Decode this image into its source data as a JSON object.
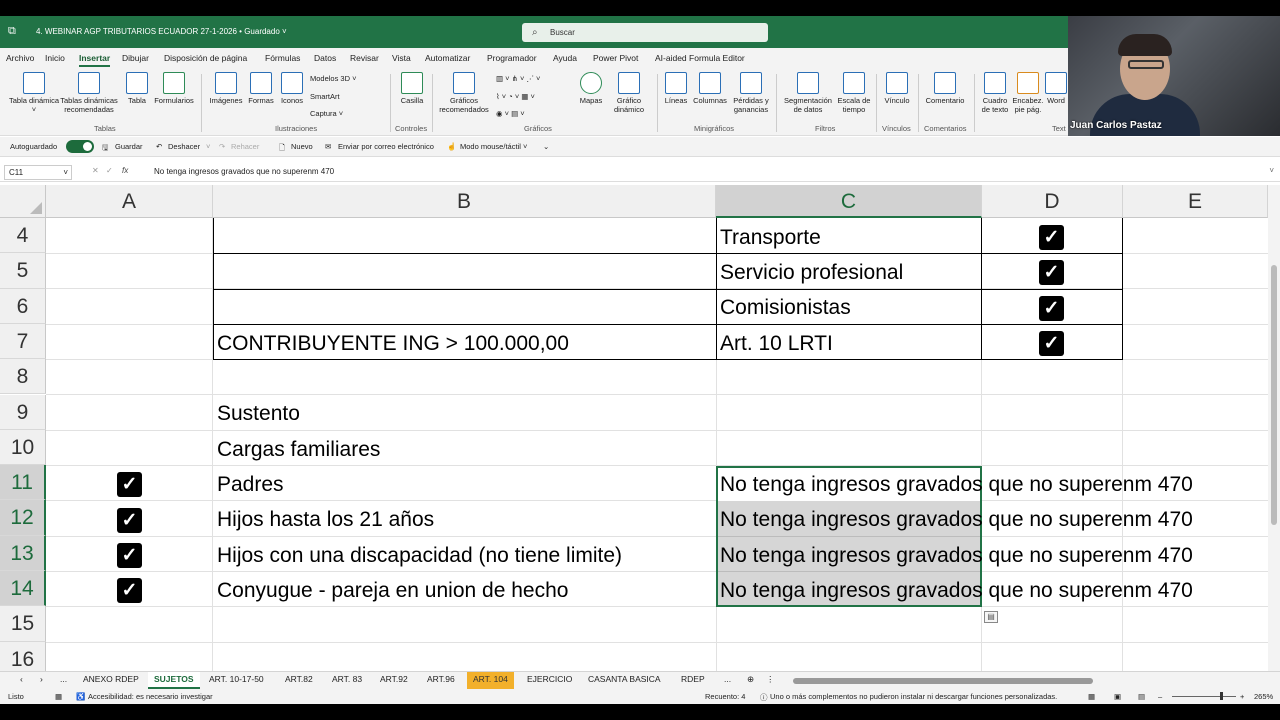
{
  "window": {
    "title": "4. WEBINAR AGP TRIBUTARIOS ECUADOR 27-1-2026 • Guardado ˅",
    "search_placeholder": "Buscar"
  },
  "menu": [
    "Archivo",
    "Inicio",
    "Insertar",
    "Dibujar",
    "Disposición de página",
    "Fórmulas",
    "Datos",
    "Revisar",
    "Vista",
    "Automatizar",
    "Programador",
    "Ayuda",
    "Power Pivot",
    "AI-aided Formula Editor"
  ],
  "ribbon": {
    "tables": {
      "items": [
        "Tabla dinámica ˅",
        "Tablas dinámicas recomendadas",
        "Tabla",
        "Formularios"
      ],
      "group": "Tablas"
    },
    "illustrations": {
      "items": [
        "Imágenes",
        "Formas",
        "Iconos"
      ],
      "small": [
        "Modelos 3D ˅",
        "SmartArt",
        "Captura ˅"
      ],
      "group": "Ilustraciones"
    },
    "controls": {
      "items": [
        "Casilla"
      ],
      "group": "Controles"
    },
    "charts": {
      "items": [
        "Gráficos recomendados",
        "Mapas",
        "Gráfico dinámico"
      ],
      "group": "Gráficos"
    },
    "sparklines": {
      "items": [
        "Líneas",
        "Columnas",
        "Pérdidas y ganancias"
      ],
      "group": "Minigráficos"
    },
    "filters": {
      "items": [
        "Segmentación de datos",
        "Escala de tiempo"
      ],
      "group": "Filtros"
    },
    "links": {
      "items": [
        "Vínculo"
      ],
      "group": "Vínculos"
    },
    "comments": {
      "items": [
        "Comentario"
      ],
      "group": "Comentarios"
    },
    "text": {
      "items": [
        "Cuadro de texto",
        "Encabez. pie pág.",
        "Word"
      ],
      "group": "Text"
    }
  },
  "qat": {
    "autosave": "Autoguardado",
    "save": "Guardar",
    "undo": "Deshacer",
    "redo": "Rehacer",
    "new": "Nuevo",
    "email": "Enviar por correo electrónico",
    "mode": "Modo mouse/táctil ˅"
  },
  "formula_bar": {
    "name_box": "C11",
    "fx": "fx",
    "content": "No tenga ingresos gravados que no superenm 470"
  },
  "grid": {
    "columns": [
      "A",
      "B",
      "C",
      "D",
      "E"
    ],
    "selected_column": "C",
    "rows": [
      "4",
      "5",
      "6",
      "7",
      "8",
      "9",
      "10",
      "11",
      "12",
      "13",
      "14",
      "15",
      "16"
    ],
    "selected_rows": [
      "11",
      "12",
      "13",
      "14"
    ],
    "cells": {
      "C4": "Transporte",
      "C5": "Servicio profesional",
      "C6": "Comisionistas",
      "B7": "CONTRIBUYENTE ING > 100.000,00",
      "C7": "Art. 10 LRTI",
      "B9": "Sustento",
      "B10": "Cargas familiares",
      "B11": "Padres",
      "B12": "Hijos hasta los 21 años",
      "B13": "Hijos con una discapacidad (no tiene limite)",
      "B14": "Conyugue - pareja en union de hecho",
      "C11": "No tenga ingresos gravados que no superenm 470",
      "C12": "No tenga ingresos gravados que no superenm 470",
      "C13": "No tenga ingresos gravados que no superenm 470",
      "C14": "No tenga ingresos gravados que no superenm 470"
    },
    "checked_cells": [
      "D4",
      "D5",
      "D6",
      "D7",
      "A11",
      "A12",
      "A13",
      "A14"
    ]
  },
  "sheets": {
    "tabs": [
      "ANEXO RDEP",
      "SUJETOS",
      "ART. 10-17-50",
      "ART.82",
      "ART. 83",
      "ART.92",
      "ART.96",
      "ART. 104",
      "EJERCICIO",
      "CASANTA BASICA",
      "RDEP"
    ],
    "active": "SUJETOS",
    "highlighted": "ART. 104",
    "more": "..."
  },
  "status": {
    "ready": "Listo",
    "accessibility": "Accesibilidad: es necesario investigar",
    "count": "Recuento: 4",
    "message": "Uno o más complementos no pudieron instalar ni descargar funciones personalizadas.",
    "zoom": "265%"
  },
  "video": {
    "name": "Juan Carlos Pastaz"
  },
  "colors": {
    "accent": "#217346",
    "highlight_tab": "#f2b02b"
  }
}
